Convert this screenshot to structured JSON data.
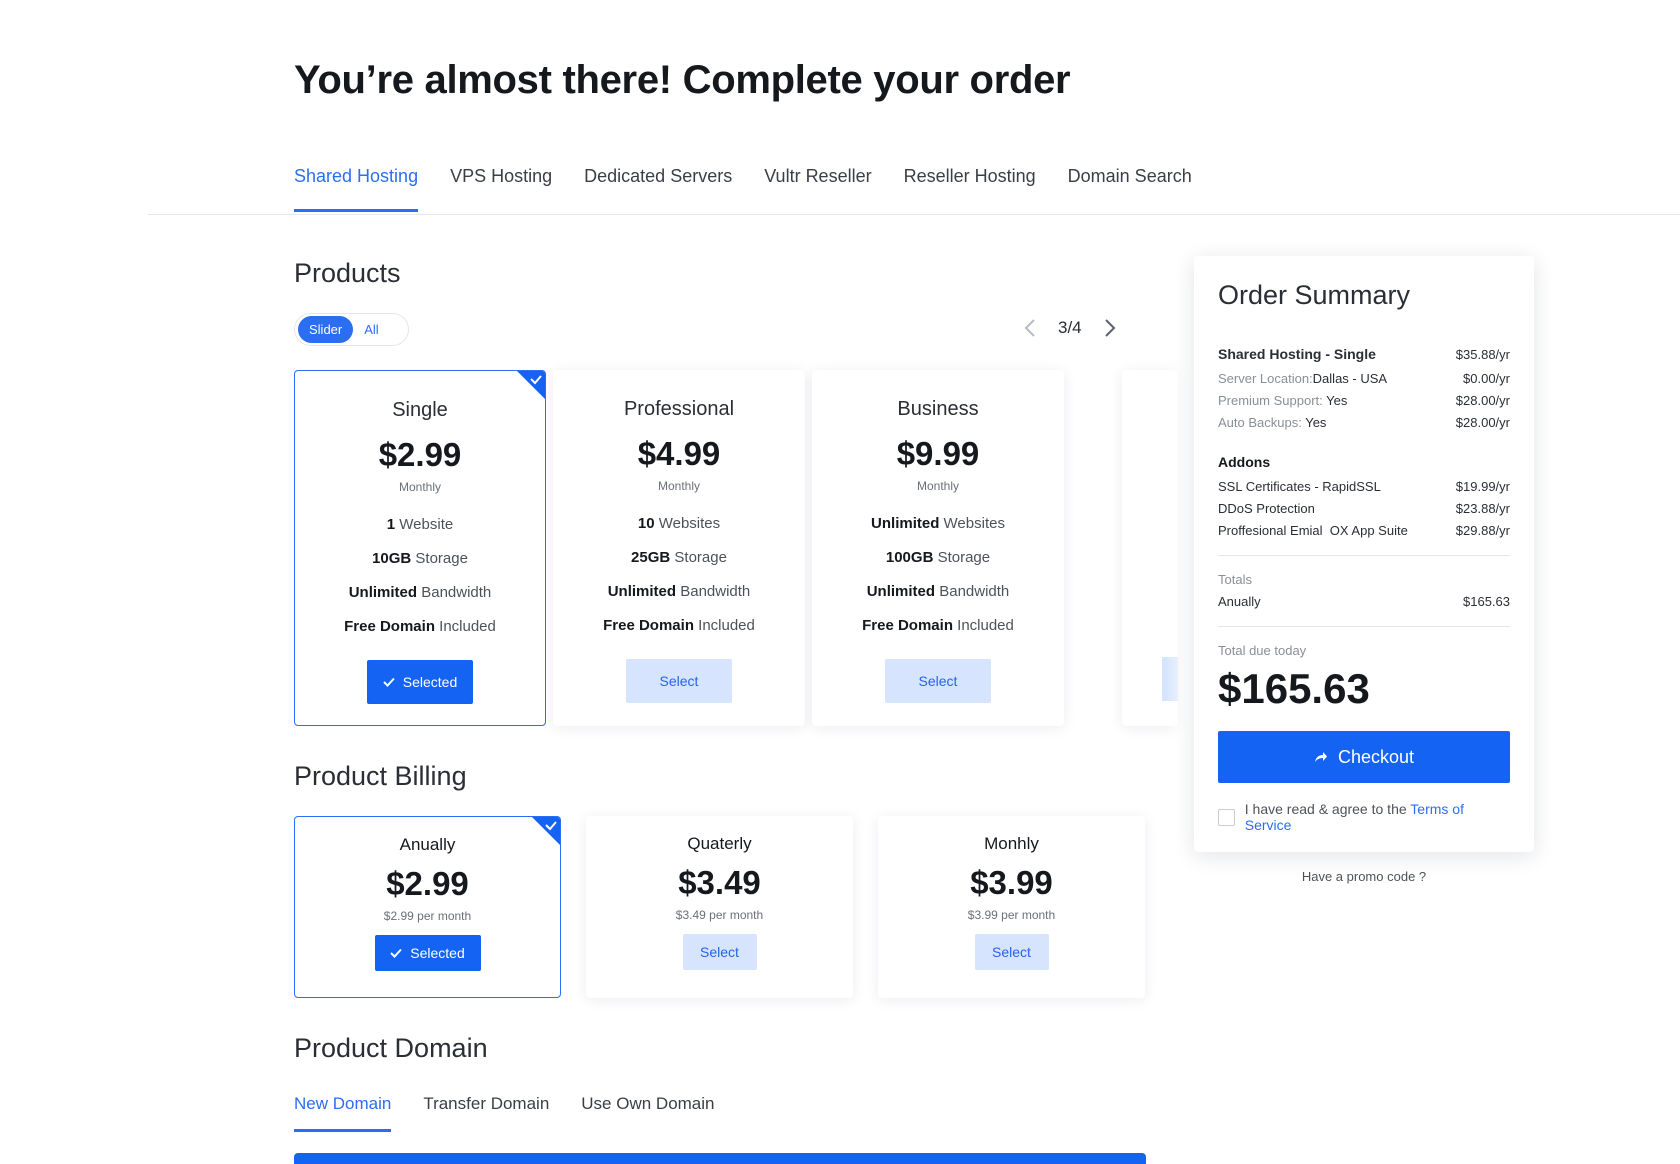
{
  "header": {
    "title": "You’re almost there! Complete your order"
  },
  "main_tabs": [
    {
      "label": "Shared Hosting",
      "active": true
    },
    {
      "label": "VPS Hosting"
    },
    {
      "label": "Dedicated Servers"
    },
    {
      "label": "Vultr Reseller"
    },
    {
      "label": "Reseller Hosting"
    },
    {
      "label": "Domain Search"
    }
  ],
  "products": {
    "title": "Products",
    "toggle": {
      "slider": "Slider",
      "all": "All",
      "active": "Slider"
    },
    "pager": "3/4",
    "cards": [
      {
        "name": "Single",
        "price": "$2.99",
        "period": "Monthly",
        "features": [
          [
            "1",
            " Website"
          ],
          [
            "10GB",
            " Storage"
          ],
          [
            "Unlimited",
            " Bandwidth"
          ],
          [
            "Free Domain",
            " Included"
          ]
        ],
        "button": "Selected",
        "selected": true
      },
      {
        "name": "Professional",
        "price": "$4.99",
        "period": "Monthly",
        "features": [
          [
            "10",
            " Websites"
          ],
          [
            "25GB",
            " Storage"
          ],
          [
            "Unlimited",
            " Bandwidth"
          ],
          [
            "Free Domain",
            " Included"
          ]
        ],
        "button": "Select",
        "selected": false
      },
      {
        "name": "Business",
        "price": "$9.99",
        "period": "Monthly",
        "features": [
          [
            "Unlimited",
            " Websites"
          ],
          [
            "100GB",
            " Storage"
          ],
          [
            "Unlimited",
            " Bandwidth"
          ],
          [
            "Free Domain",
            " Included"
          ]
        ],
        "button": "Select",
        "selected": false
      }
    ]
  },
  "billing": {
    "title": "Product Billing",
    "cards": [
      {
        "name": "Anually",
        "price": "$2.99",
        "sub": "$2.99 per month",
        "button": "Selected",
        "selected": true
      },
      {
        "name": "Quaterly",
        "price": "$3.49",
        "sub": "$3.49 per month",
        "button": "Select",
        "selected": false
      },
      {
        "name": "Monhly",
        "price": "$3.99",
        "sub": "$3.99 per month",
        "button": "Select",
        "selected": false
      }
    ]
  },
  "domain": {
    "title": "Product Domain",
    "tabs": [
      {
        "label": "New Domain",
        "active": true
      },
      {
        "label": "Transfer Domain"
      },
      {
        "label": "Use Own Domain"
      }
    ]
  },
  "summary": {
    "title": "Order Summary",
    "plan": {
      "label": "Shared Hosting - Single",
      "amount": "$35.88/yr"
    },
    "plan_lines": [
      {
        "key": "Server Location:",
        "value": "Dallas - USA",
        "amount": "$0.00/yr"
      },
      {
        "key": "Premium Support: ",
        "value": "Yes",
        "amount": "$28.00/yr"
      },
      {
        "key": "Auto Backups: ",
        "value": "Yes",
        "amount": "$28.00/yr"
      }
    ],
    "addons_title": "Addons",
    "addons": [
      {
        "label": "SSL Certificates - RapidSSL",
        "amount": "$19.99/yr"
      },
      {
        "label": "DDoS Protection",
        "amount": "$23.88/yr"
      },
      {
        "label": "Proffesional Emial  OX App Suite",
        "amount": "$29.88/yr"
      }
    ],
    "totals_label": "Totals",
    "annual": {
      "label": "Anually",
      "amount": "$165.63"
    },
    "due_label": "Total due today",
    "due_amount": "$165.63",
    "checkout": "Checkout",
    "agree_text": "I have read & agree to the ",
    "tos": "Terms of Service",
    "promo": "Have a promo code ?"
  },
  "colors": {
    "accent": "#1463f3",
    "accent_light": "#d6e4fd",
    "tab_active": "#2b6ef2"
  }
}
